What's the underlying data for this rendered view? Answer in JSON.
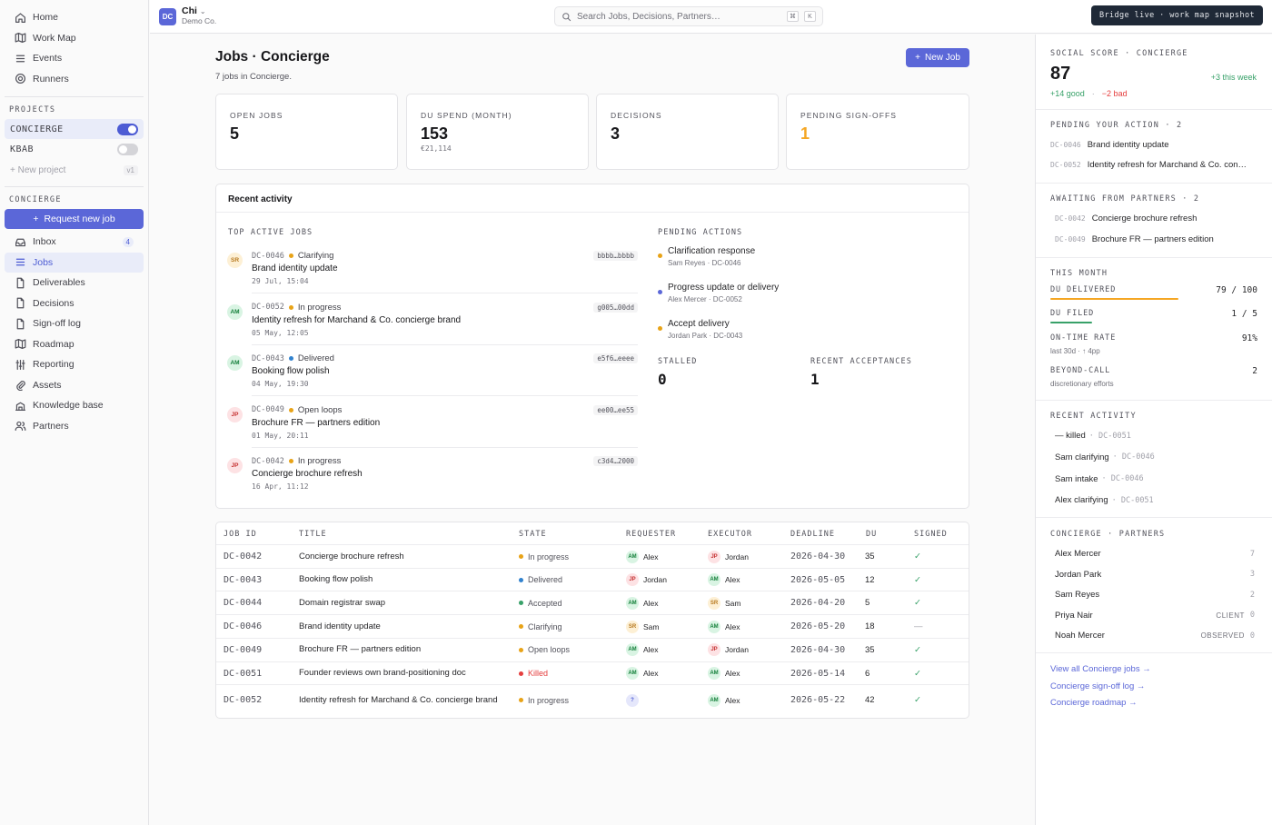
{
  "sidebar": {
    "nav": [
      {
        "label": "Home",
        "icon": "home-icon"
      },
      {
        "label": "Work Map",
        "icon": "map-icon"
      },
      {
        "label": "Events",
        "icon": "list-icon"
      },
      {
        "label": "Runners",
        "icon": "target-icon"
      }
    ],
    "projects_header": "PROJECTS",
    "projects": [
      {
        "label": "CONCIERGE",
        "enabled": true
      },
      {
        "label": "KBAB",
        "enabled": false
      }
    ],
    "new_project": "New project",
    "new_project_tag": "v1",
    "section_header": "CONCIERGE",
    "request_button": "Request new job",
    "section_nav": [
      {
        "label": "Inbox",
        "icon": "inbox-icon",
        "badge": "4"
      },
      {
        "label": "Jobs",
        "icon": "list-icon",
        "active": true
      },
      {
        "label": "Deliverables",
        "icon": "file-icon"
      },
      {
        "label": "Decisions",
        "icon": "file-icon"
      },
      {
        "label": "Sign-off log",
        "icon": "file-icon"
      },
      {
        "label": "Roadmap",
        "icon": "map-icon"
      },
      {
        "label": "Reporting",
        "icon": "sliders-icon"
      },
      {
        "label": "Assets",
        "icon": "paperclip-icon"
      },
      {
        "label": "Knowledge base",
        "icon": "building-icon"
      },
      {
        "label": "Partners",
        "icon": "users-icon"
      }
    ]
  },
  "topbar": {
    "workspace_initials": "DC",
    "workspace_name": "Chi",
    "workspace_sub": "Demo Co.",
    "search_placeholder": "Search Jobs, Decisions, Partners…",
    "kbd1": "⌘",
    "kbd2": "K",
    "bridge": "Bridge live · work map snapshot"
  },
  "page": {
    "title": "Jobs · Concierge",
    "subtitle": "7 jobs in Concierge.",
    "new_job": "New Job"
  },
  "stats": [
    {
      "label": "OPEN JOBS",
      "value": "5",
      "sub": ""
    },
    {
      "label": "DU SPEND (MONTH)",
      "value": "153",
      "sub": "€21,114"
    },
    {
      "label": "DECISIONS",
      "value": "3",
      "sub": ""
    },
    {
      "label": "PENDING SIGN-OFFS",
      "value": "1",
      "sub": "",
      "color": "#f5a623"
    }
  ],
  "activity": {
    "title": "Recent activity",
    "top_jobs_label": "TOP ACTIVE JOBS",
    "top_jobs": [
      {
        "avatar": "SR",
        "avatar_kind": "sr",
        "id": "DC-0046",
        "state": "Clarifying",
        "state_color": "#e8a317",
        "title": "Brand identity update",
        "time": "29 Jul, 15:04",
        "hash": "bbbb…bbbb"
      },
      {
        "avatar": "AM",
        "avatar_kind": "am",
        "id": "DC-0052",
        "state": "In progress",
        "state_color": "#e8a317",
        "title": "Identity refresh for Marchand & Co. concierge brand",
        "time": "05 May, 12:05",
        "hash": "g005…00dd"
      },
      {
        "avatar": "AM",
        "avatar_kind": "am",
        "id": "DC-0043",
        "state": "Delivered",
        "state_color": "#3182ce",
        "title": "Booking flow polish",
        "time": "04 May, 19:30",
        "hash": "e5f6…eeee"
      },
      {
        "avatar": "JP",
        "avatar_kind": "jp",
        "id": "DC-0049",
        "state": "Open loops",
        "state_color": "#e8a317",
        "title": "Brochure FR — partners edition",
        "time": "01 May, 20:11",
        "hash": "ee00…ee55"
      },
      {
        "avatar": "JP",
        "avatar_kind": "jp",
        "id": "DC-0042",
        "state": "In progress",
        "state_color": "#e8a317",
        "title": "Concierge brochure refresh",
        "time": "16 Apr, 11:12",
        "hash": "c3d4…2000"
      }
    ],
    "pending_label": "PENDING ACTIONS",
    "pending": [
      {
        "title": "Clarification response",
        "sub": "Sam Reyes · DC-0046",
        "color": "#e8a317"
      },
      {
        "title": "Progress update or delivery",
        "sub": "Alex Mercer · DC-0052",
        "color": "#5b67d8"
      },
      {
        "title": "Accept delivery",
        "sub": "Jordan Park · DC-0043",
        "color": "#e8a317"
      }
    ],
    "stalled_label": "STALLED",
    "stalled_value": "0",
    "acceptances_label": "RECENT ACCEPTANCES",
    "acceptances_value": "1"
  },
  "table": {
    "headers": [
      "JOB ID",
      "TITLE",
      "STATE",
      "REQUESTER",
      "EXECUTOR",
      "DEADLINE",
      "DU",
      "SIGNED"
    ],
    "rows": [
      {
        "id": "DC-0042",
        "title": "Concierge brochure refresh",
        "state": "In progress",
        "state_color": "#e8a317",
        "req": "AM",
        "req_name": "Alex",
        "req_kind": "am",
        "exe": "JP",
        "exe_name": "Jordan",
        "exe_kind": "jp",
        "deadline": "2026-04-30",
        "du": "35",
        "signed": "✓"
      },
      {
        "id": "DC-0043",
        "title": "Booking flow polish",
        "state": "Delivered",
        "state_color": "#3182ce",
        "req": "JP",
        "req_name": "Jordan",
        "req_kind": "jp",
        "exe": "AM",
        "exe_name": "Alex",
        "exe_kind": "am",
        "deadline": "2026-05-05",
        "du": "12",
        "signed": "✓"
      },
      {
        "id": "DC-0044",
        "title": "Domain registrar swap",
        "state": "Accepted",
        "state_color": "#38a169",
        "req": "AM",
        "req_name": "Alex",
        "req_kind": "am",
        "exe": "SR",
        "exe_name": "Sam",
        "exe_kind": "sr",
        "deadline": "2026-04-20",
        "du": "5",
        "signed": "✓"
      },
      {
        "id": "DC-0046",
        "title": "Brand identity update",
        "state": "Clarifying",
        "state_color": "#e8a317",
        "req": "SR",
        "req_name": "Sam",
        "req_kind": "sr",
        "exe": "AM",
        "exe_name": "Alex",
        "exe_kind": "am",
        "deadline": "2026-05-20",
        "du": "18",
        "signed": "—"
      },
      {
        "id": "DC-0049",
        "title": "Brochure FR — partners edition",
        "state": "Open loops",
        "state_color": "#e8a317",
        "req": "AM",
        "req_name": "Alex",
        "req_kind": "am",
        "exe": "JP",
        "exe_name": "Jordan",
        "exe_kind": "jp",
        "deadline": "2026-04-30",
        "du": "35",
        "signed": "✓"
      },
      {
        "id": "DC-0051",
        "title": "Founder reviews own brand-positioning doc",
        "state": "Killed",
        "state_color": "#e53e3e",
        "req": "AM",
        "req_name": "Alex",
        "req_kind": "am",
        "exe": "AM",
        "exe_name": "Alex",
        "exe_kind": "am",
        "deadline": "2026-05-14",
        "du": "6",
        "signed": "✓"
      },
      {
        "id": "DC-0052",
        "title": "Identity refresh for Marchand & Co. concierge brand",
        "state": "In progress",
        "state_color": "#e8a317",
        "req": "?",
        "req_name": "",
        "req_kind": "q",
        "exe": "AM",
        "exe_name": "Alex",
        "exe_kind": "am",
        "deadline": "2026-05-22",
        "du": "42",
        "signed": "✓"
      }
    ]
  },
  "right": {
    "social_label": "SOCIAL SCORE · CONCIERGE",
    "social_value": "87",
    "social_week": "+3 this week",
    "social_good": "+14 good",
    "social_sep": "·",
    "social_bad": "−2 bad",
    "pending_label": "PENDING YOUR ACTION · 2",
    "pending": [
      {
        "id": "DC-0046",
        "title": "Brand identity update"
      },
      {
        "id": "DC-0052",
        "title": "Identity refresh for Marchand & Co. con…"
      }
    ],
    "awaiting_label": "AWAITING FROM PARTNERS · 2",
    "awaiting": [
      {
        "id": "DC-0042",
        "title": "Concierge brochure refresh"
      },
      {
        "id": "DC-0049",
        "title": "Brochure FR — partners edition"
      }
    ],
    "month_label": "THIS MONTH",
    "du_delivered_label": "DU DELIVERED",
    "du_delivered_value": "79 / 100",
    "du_delivered_fraction": 0.79,
    "du_filed_label": "DU FILED",
    "du_filed_value": "1 / 5",
    "du_filed_fraction": 0.2,
    "ontime_label": "ON-TIME RATE",
    "ontime_value": "91%",
    "ontime_sub": "last 30d · ↑ 4pp",
    "beyond_label": "BEYOND-CALL",
    "beyond_value": "2",
    "beyond_sub": "discretionary efforts",
    "recent_label": "RECENT ACTIVITY",
    "recent": [
      {
        "who": "— killed",
        "ref": "· DC-0051"
      },
      {
        "who": "Sam clarifying",
        "ref": "· DC-0046"
      },
      {
        "who": "Sam intake",
        "ref": "· DC-0046"
      },
      {
        "who": "Alex clarifying",
        "ref": "· DC-0051"
      }
    ],
    "partners_label": "CONCIERGE · PARTNERS",
    "partners": [
      {
        "name": "Alex Mercer",
        "tag": "",
        "count": "7"
      },
      {
        "name": "Jordan Park",
        "tag": "",
        "count": "3"
      },
      {
        "name": "Sam Reyes",
        "tag": "",
        "count": "2"
      },
      {
        "name": "Priya Nair",
        "tag": "CLIENT",
        "count": "0"
      },
      {
        "name": "Noah Mercer",
        "tag": "OBSERVED",
        "count": "0"
      }
    ],
    "links": [
      "View all Concierge jobs →",
      "Concierge sign-off log →",
      "Concierge roadmap →"
    ]
  }
}
